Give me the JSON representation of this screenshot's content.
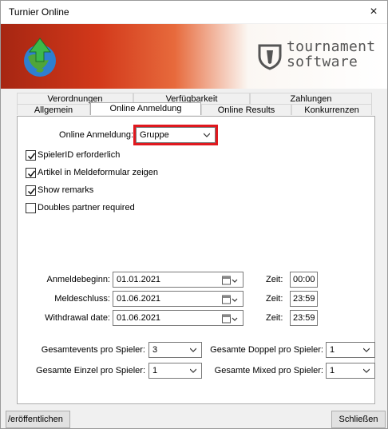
{
  "window": {
    "title": "Turnier Online",
    "close_glyph": "×"
  },
  "banner": {
    "brand_line1": "tournament",
    "brand_line2": "software",
    "logo_icon": "upload-globe-icon",
    "brand_icon": "shield-icon"
  },
  "tabs": {
    "row_back": [
      "Verordnungen",
      "Verfügbarkeit",
      "Zahlungen"
    ],
    "row_front": [
      "Allgemein",
      "Online Anmeldung",
      "Online Results",
      "Konkurrenzen"
    ],
    "active": "Online Anmeldung"
  },
  "form": {
    "online_anmeldung_label": "Online Anmeldung:",
    "online_anmeldung_value": "Gruppe",
    "checkboxes": [
      {
        "label": "SpielerID erforderlich",
        "checked": true
      },
      {
        "label": "Artikel in Meldeformular zeigen",
        "checked": true
      },
      {
        "label": "Show remarks",
        "checked": true
      },
      {
        "label": "Doubles partner required",
        "checked": false
      }
    ],
    "dates": [
      {
        "label": "Anmeldebeginn:",
        "date": "01.01.2021",
        "time_label": "Zeit:",
        "time": "00:00"
      },
      {
        "label": "Meldeschluss:",
        "date": "01.06.2021",
        "time_label": "Zeit:",
        "time": "23:59"
      },
      {
        "label": "Withdrawal date:",
        "date": "01.06.2021",
        "time_label": "Zeit:",
        "time": "23:59"
      }
    ],
    "limits": [
      {
        "label": "Gesamtevents pro Spieler:",
        "value": "3"
      },
      {
        "label": "Gesamte Doppel pro Spieler:",
        "value": "1"
      },
      {
        "label": "Gesamte Einzel pro Spieler:",
        "value": "1"
      },
      {
        "label": "Gesamte Mixed pro Spieler:",
        "value": "1"
      }
    ]
  },
  "buttons": {
    "publish": "/eröffentlichen",
    "close": "Schließen"
  },
  "colors": {
    "highlight": "#e0181e",
    "banner_red": "#d2381a"
  }
}
